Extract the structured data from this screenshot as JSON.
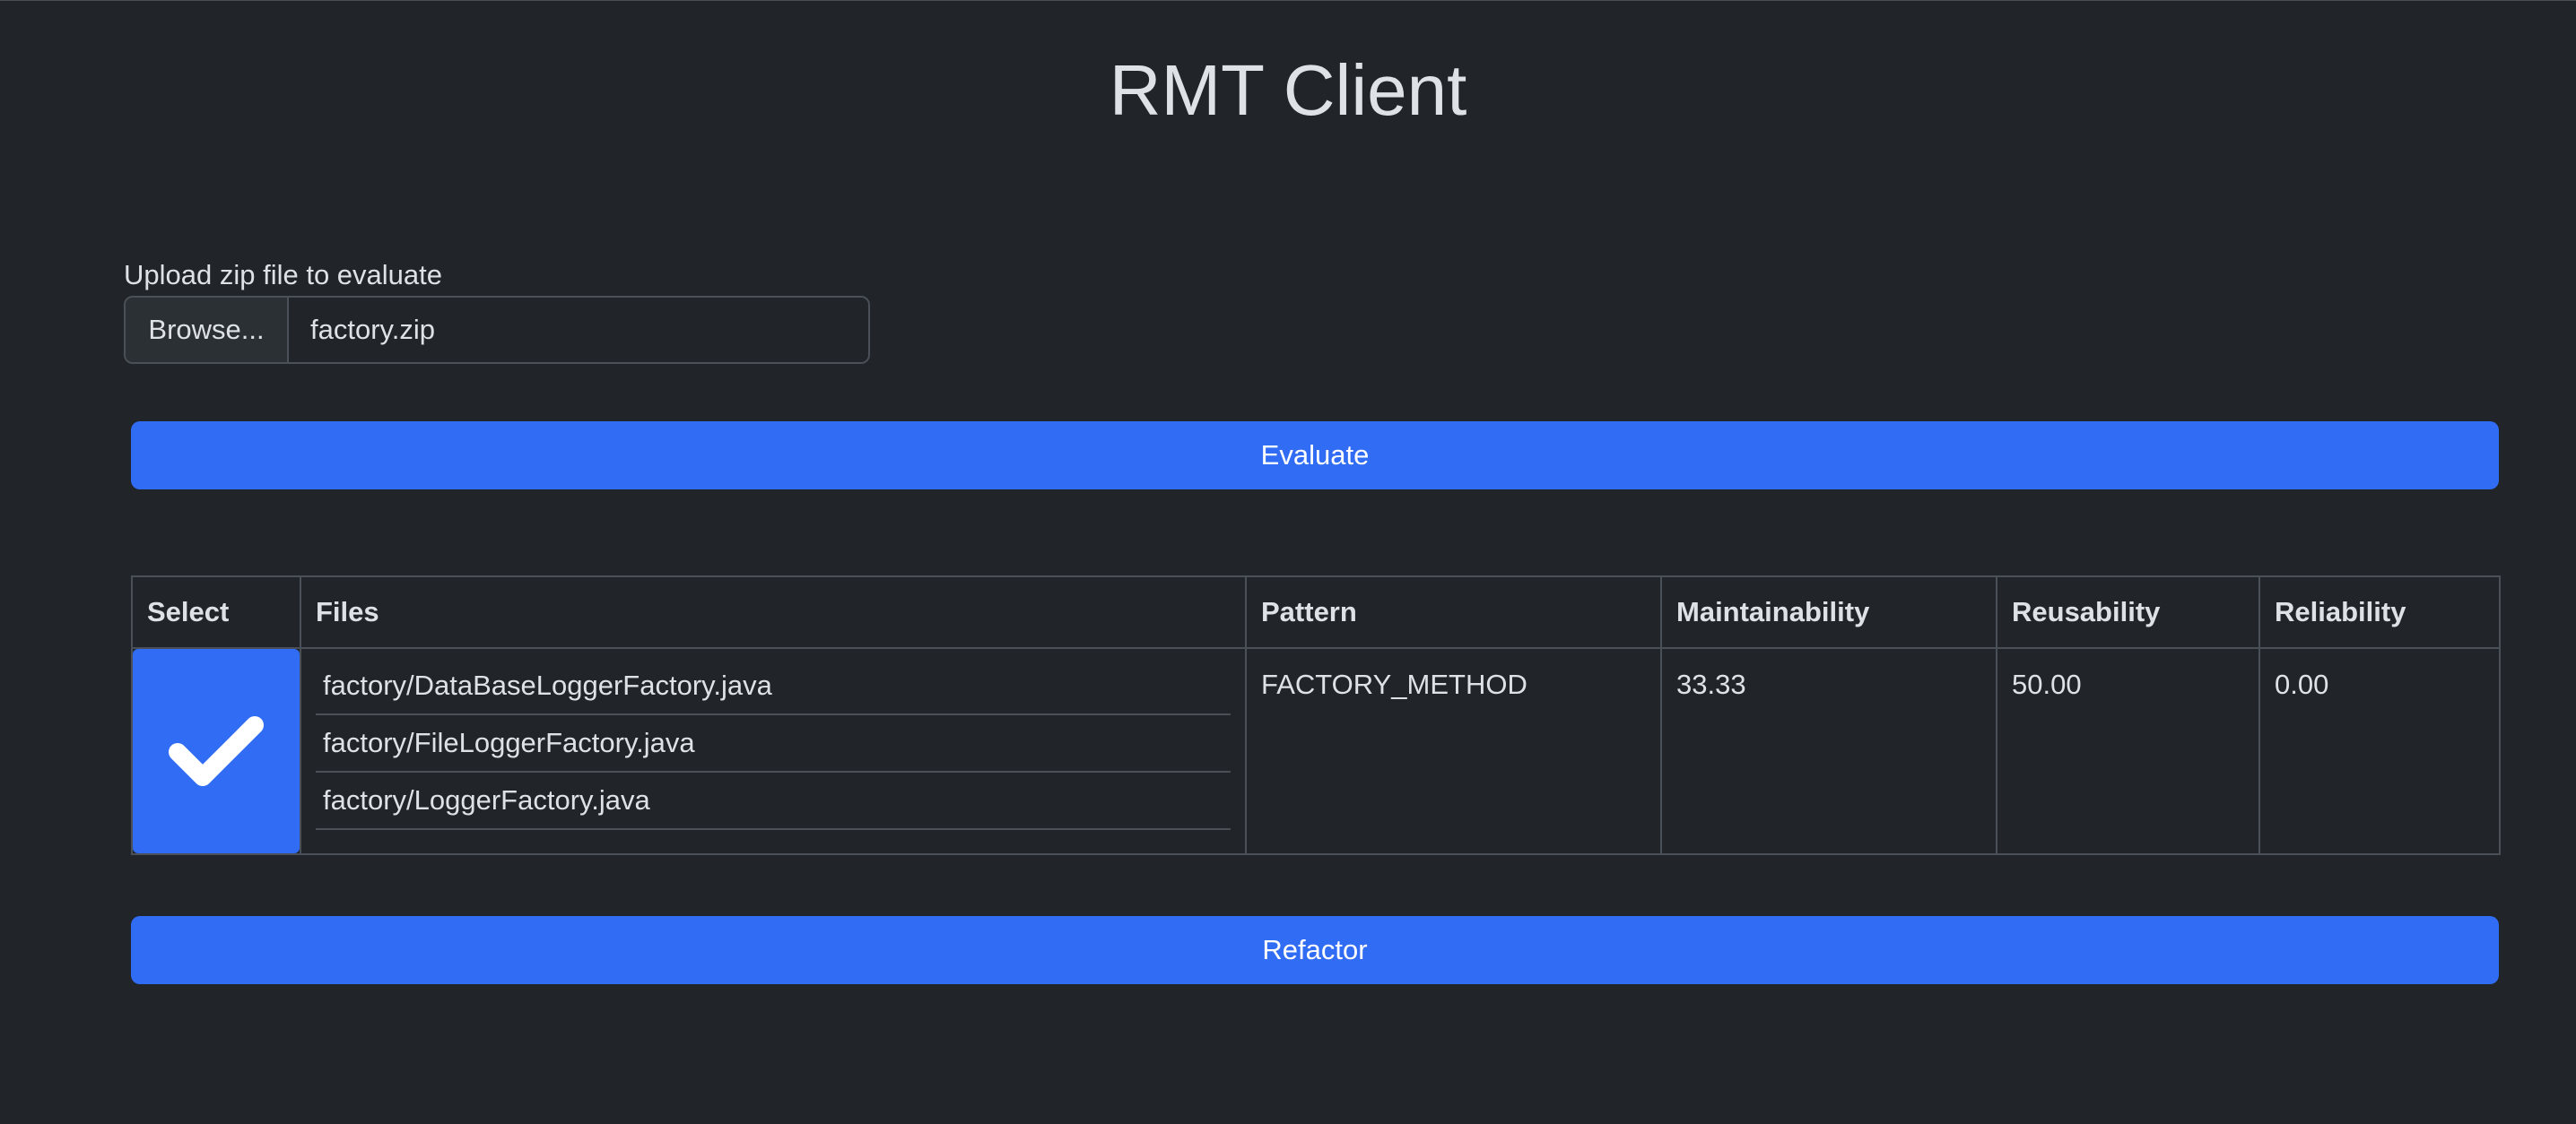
{
  "app": {
    "title": "RMT Client"
  },
  "upload": {
    "label": "Upload zip file to evaluate",
    "browse_label": "Browse...",
    "file_name": "factory.zip"
  },
  "actions": {
    "evaluate_label": "Evaluate",
    "refactor_label": "Refactor"
  },
  "table": {
    "headers": [
      "Select",
      "Files",
      "Pattern",
      "Maintainability",
      "Reusability",
      "Reliability"
    ],
    "rows": [
      {
        "selected": true,
        "files": [
          "factory/DataBaseLoggerFactory.java",
          "factory/FileLoggerFactory.java",
          "factory/LoggerFactory.java"
        ],
        "pattern": "FACTORY_METHOD",
        "maintainability": "33.33",
        "reusability": "50.00",
        "reliability": "0.00"
      }
    ]
  },
  "colors": {
    "background": "#212529",
    "accent": "#316cf4",
    "border": "#495057",
    "text": "#dee2e6"
  },
  "icons": {
    "checkbox": "checkmark-icon"
  }
}
